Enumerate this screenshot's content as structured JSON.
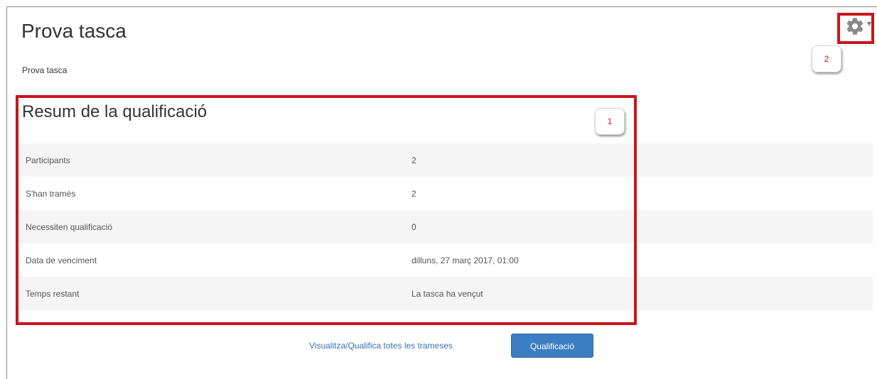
{
  "page": {
    "title": "Prova tasca",
    "intro": "Prova tasca"
  },
  "settings_menu": {
    "icon": "gear-icon",
    "caret": "▾"
  },
  "callouts": {
    "summary": "1",
    "settings": "2"
  },
  "summary": {
    "heading": "Resum de la qualificació",
    "rows": [
      {
        "label": "Participants",
        "value": "2"
      },
      {
        "label": "S'han tramès",
        "value": "2"
      },
      {
        "label": "Necessiten qualificació",
        "value": "0"
      },
      {
        "label": "Data de venciment",
        "value": "dilluns, 27 març 2017, 01:00"
      },
      {
        "label": "Temps restant",
        "value": "La tasca ha vençut"
      }
    ]
  },
  "actions": {
    "view_all_link": "Visualitza/Qualifica totes les trameses",
    "grade_button": "Qualificació"
  },
  "colors": {
    "highlight": "#c8161d",
    "link": "#3873b2",
    "button": "#3b7ec1"
  }
}
